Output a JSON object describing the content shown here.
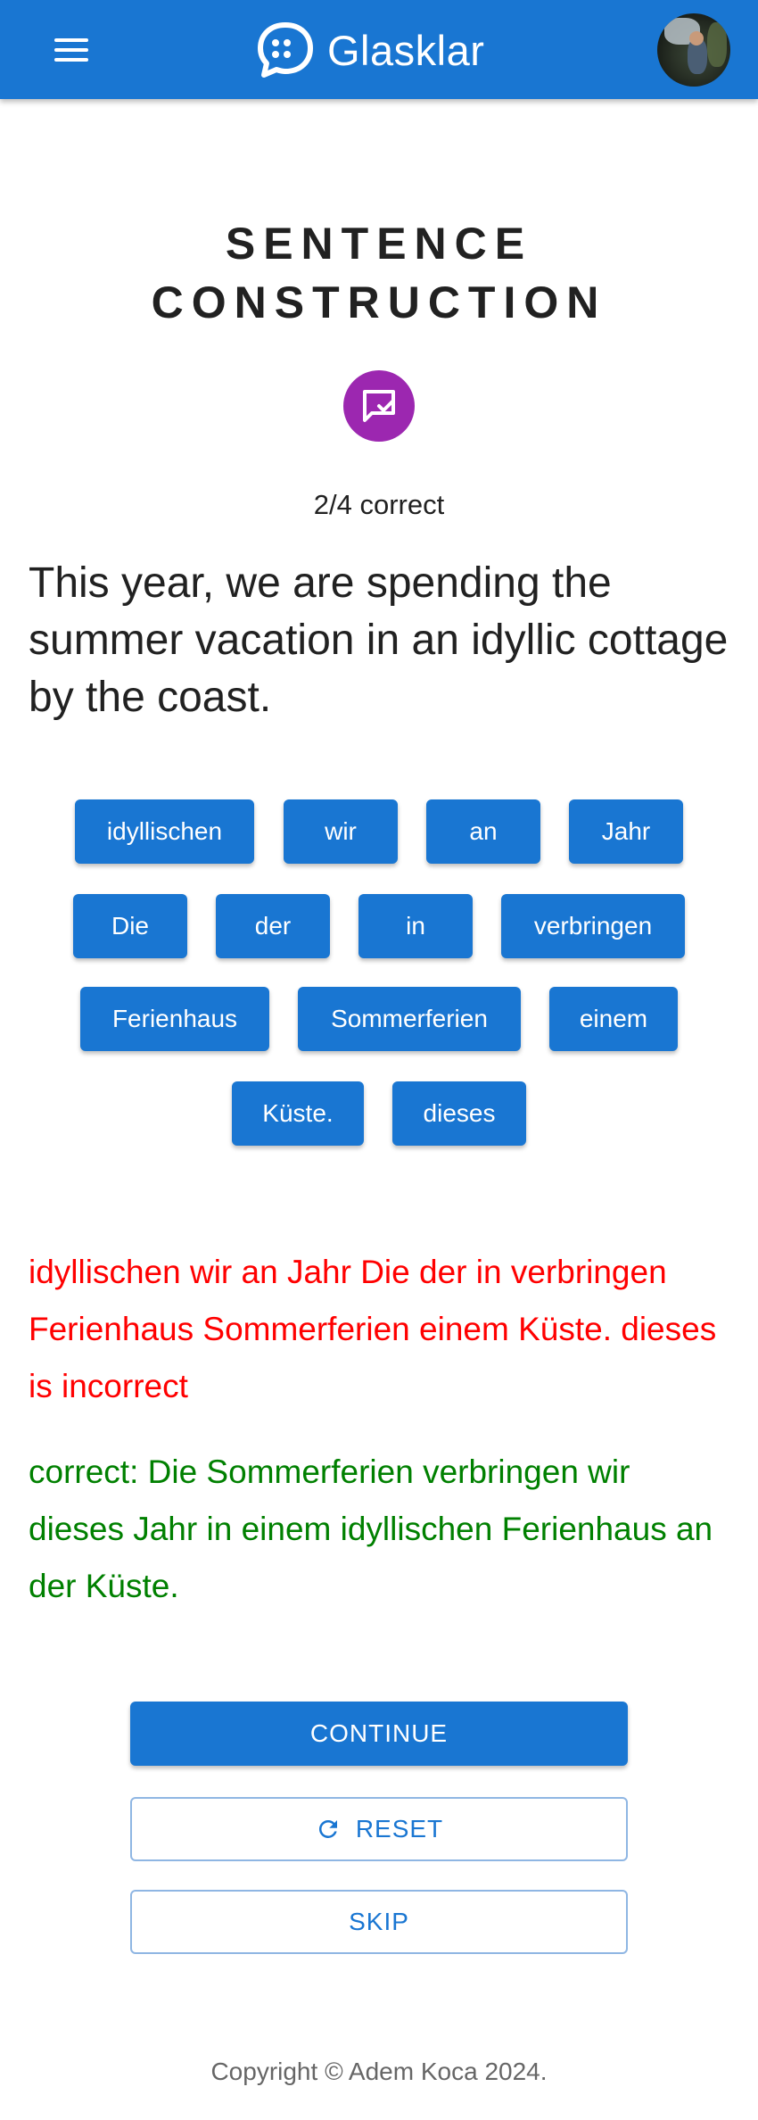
{
  "header": {
    "brand_name": "Glasklar",
    "menu_icon": "hamburger-menu-icon",
    "logo_icon": "chat-bubble-icon",
    "avatar": "user-avatar",
    "bar_color": "#1976d2"
  },
  "exercise": {
    "title_line1": "SENTENCE",
    "title_line2": "CONSTRUCTION",
    "badge_icon": "message-check-icon",
    "badge_color": "#9c27b0",
    "score": "2/4 correct",
    "prompt": "This year, we are spending the summer vacation in an idyllic cottage by the coast."
  },
  "words": [
    "idyllischen",
    "wir",
    "an",
    "Jahr",
    "Die",
    "der",
    "in",
    "verbringen",
    "Ferienhaus",
    "Sommerferien",
    "einem",
    "Küste.",
    "dieses"
  ],
  "feedback": {
    "incorrect": "idyllischen wir an Jahr Die der in verbringen Ferienhaus Sommerferien einem Küste. dieses is incorrect",
    "incorrect_color": "#ff0000",
    "correct": "correct: Die Sommerferien verbringen wir dieses Jahr in einem idyllischen Ferienhaus an der Küste.",
    "correct_color": "#008000"
  },
  "actions": {
    "continue_label": "CONTINUE",
    "reset_label": "RESET",
    "reset_icon": "refresh-icon",
    "skip_label": "SKIP"
  },
  "footer": {
    "copyright": "Copyright © Adem Koca 2024."
  }
}
